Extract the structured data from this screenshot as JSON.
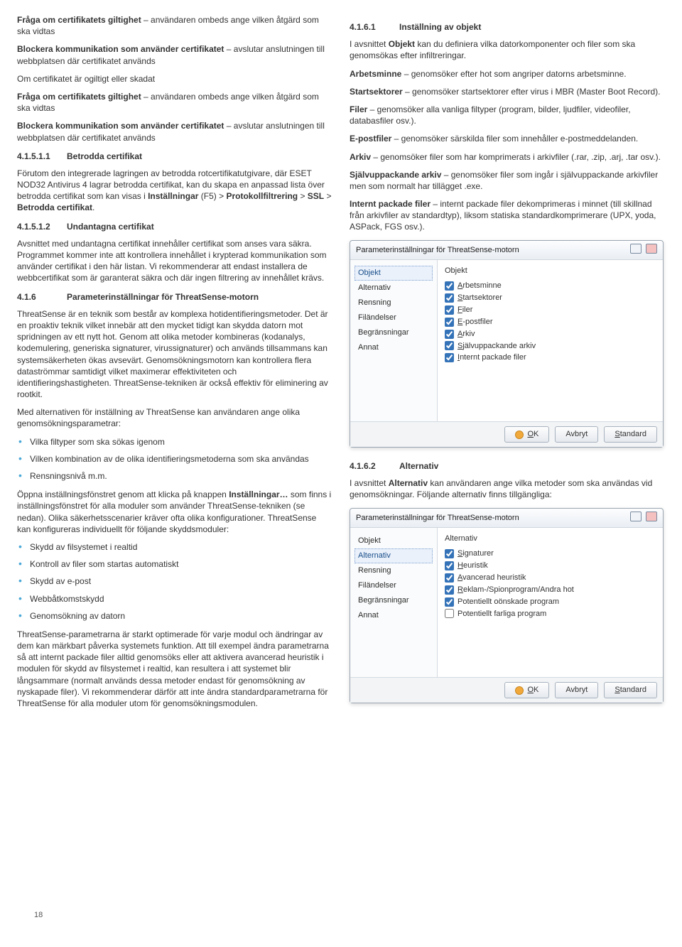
{
  "page_number": "18",
  "left": {
    "p1a": "Fråga om certifikatets giltighet",
    "p1b": " – användaren ombeds ange vilken åtgärd som ska vidtas",
    "p2a": "Blockera kommunikation som använder certifikatet",
    "p2b": " – avslutar anslutningen till webbplatsen där certifikatet används",
    "p3": "Om certifikatet är ogiltigt eller skadat",
    "p4a": "Fråga om certifikatets giltighet",
    "p4b": " – användaren ombeds ange vilken åtgärd som ska vidtas",
    "p5a": "Blockera kommunikation som använder certifikatet",
    "p5b": " – avslutar anslutningen till webbplatsen där certifikatet används",
    "h1": {
      "num": "4.1.5.1.1",
      "title": "Betrodda certifikat"
    },
    "p6a": "Förutom den integrerade lagringen av betrodda rotcertifikatutgivare, där ESET NOD32 Antivirus 4 lagrar betrodda certifikat, kan du skapa en anpassad lista över betrodda certifikat som kan visas i ",
    "p6b": "Inställningar",
    "p6c": " (F5) > ",
    "p6d": "Protokollfiltrering",
    "p6e": " > ",
    "p6f": "SSL",
    "p6g": " > ",
    "p6h": "Betrodda certifikat",
    "p6i": ".",
    "h2": {
      "num": "4.1.5.1.2",
      "title": "Undantagna certifikat"
    },
    "p7": "Avsnittet med undantagna certifikat innehåller certifikat som anses vara säkra. Programmet kommer inte att kontrollera innehållet i krypterad kommunikation som använder certifikat i den här listan. Vi rekommenderar att endast installera de webbcertifikat som är garanterat säkra och där ingen filtrering av innehållet krävs.",
    "h3": {
      "num": "4.1.6",
      "title": "Parameterinställningar för ThreatSense-motorn"
    },
    "p8": "ThreatSense är en teknik som består av komplexa hotidentifieringsmetoder. Det är en proaktiv teknik vilket innebär att den mycket tidigt kan skydda datorn mot spridningen av ett nytt hot. Genom att olika metoder kombineras (kodanalys, kodemulering, generiska signaturer, virussignaturer) och används tillsammans kan systemsäkerheten ökas avsevärt. Genomsökningsmotorn kan kontrollera flera dataströmmar samtidigt vilket maximerar effektiviteten och identifieringshastigheten. ThreatSense-tekniken är också effektiv för eliminering av rootkit.",
    "p9": "Med alternativen för inställning av ThreatSense kan användaren ange olika genomsökningsparametrar:",
    "bul1": [
      "Vilka filtyper som ska sökas igenom",
      "Vilken kombination av de olika identifieringsmetoderna som ska användas",
      "Rensningsnivå m.m."
    ],
    "p10a": "Öppna inställningsfönstret genom att klicka på knappen ",
    "p10b": "Inställningar…",
    "p10c": " som finns i inställningsfönstret för alla moduler som använder ThreatSense-tekniken (se nedan). Olika säkerhetsscenarier kräver ofta olika konfigurationer. ThreatSense kan konfigureras individuellt för följande skyddsmoduler:",
    "bul2": [
      "Skydd av filsystemet i realtid",
      "Kontroll av filer som startas automatiskt",
      "Skydd av e-post",
      "Webbåtkomstskydd",
      "Genomsökning av datorn"
    ],
    "p11": "ThreatSense-parametrarna är starkt optimerade för varje modul och ändringar av dem kan märkbart påverka systemets funktion. Att till exempel ändra parametrarna så att internt packade filer alltid genomsöks eller att aktivera avancerad heuristik i modulen för skydd av filsystemet i realtid, kan resultera i att systemet blir långsammare (normalt används dessa metoder endast för genomsökning av nyskapade filer). Vi rekommenderar därför att inte ändra standardparametrarna för ThreatSense för alla moduler utom för genomsökningsmodulen."
  },
  "right": {
    "h1": {
      "num": "4.1.6.1",
      "title": "Inställning av objekt"
    },
    "p1a": "I avsnittet ",
    "p1b": "Objekt",
    "p1c": " kan du definiera vilka datorkomponenter och filer som ska genomsökas efter infiltreringar.",
    "p2a": "Arbetsminne",
    "p2b": " – genomsöker efter hot som angriper datorns arbetsminne.",
    "p3a": "Startsektorer",
    "p3b": " – genomsöker startsektorer efter virus i MBR (Master Boot Record).",
    "p4a": "Filer",
    "p4b": " – genomsöker alla vanliga filtyper (program, bilder, ljudfiler, videofiler, databasfiler osv.).",
    "p5a": "E-postfiler",
    "p5b": " – genomsöker särskilda filer som innehåller e-postmeddelanden.",
    "p6a": "Arkiv",
    "p6b": " – genomsöker filer som har komprimerats i arkivfiler (.rar, .zip, .arj, .tar osv.).",
    "p7a": "Självuppackande arkiv",
    "p7b": " – genomsöker filer som ingår i självuppackande arkivfiler men som normalt har tillägget .exe.",
    "p8a": "Internt packade filer",
    "p8b": " – internt packade filer dekomprimeras i minnet (till skillnad från arkivfiler av standardtyp), liksom statiska standardkomprimerare (UPX, yoda, ASPack, FGS osv.).",
    "h2": {
      "num": "4.1.6.2",
      "title": "Alternativ"
    },
    "p9a": "I avsnittet ",
    "p9b": "Alternativ",
    "p9c": " kan användaren ange vilka metoder som ska användas vid genomsökningar. Följande alternativ finns tillgängliga:"
  },
  "dialog1": {
    "title": "Parameterinställningar för ThreatSense-motorn",
    "side": [
      "Objekt",
      "Alternativ",
      "Rensning",
      "Filändelser",
      "Begränsningar",
      "Annat"
    ],
    "selected": "Objekt",
    "group_title": "Objekt",
    "checks": [
      {
        "label_pre": "A",
        "label": "rbetsminne",
        "checked": true
      },
      {
        "label_pre": "S",
        "label": "tartsektorer",
        "checked": true
      },
      {
        "label_pre": "F",
        "label": "iler",
        "checked": true
      },
      {
        "label_pre": "E",
        "label": "-postfiler",
        "checked": true
      },
      {
        "label_pre": "A",
        "label": "rkiv",
        "checked": true
      },
      {
        "label_pre": "S",
        "label": "jälvuppackande arkiv",
        "checked": true
      },
      {
        "label_pre": "I",
        "label": "nternt packade filer",
        "checked": true
      }
    ],
    "buttons": {
      "ok_pre": "O",
      "ok": "K",
      "cancel": "Avbryt",
      "std_pre": "S",
      "std": "tandard"
    }
  },
  "dialog2": {
    "title": "Parameterinställningar för ThreatSense-motorn",
    "side": [
      "Objekt",
      "Alternativ",
      "Rensning",
      "Filändelser",
      "Begränsningar",
      "Annat"
    ],
    "selected": "Alternativ",
    "group_title": "Alternativ",
    "checks": [
      {
        "label_pre": "S",
        "label": "ignaturer",
        "checked": true
      },
      {
        "label_pre": "H",
        "label": "euristik",
        "checked": true
      },
      {
        "label_pre": "A",
        "label": "vancerad heuristik",
        "checked": true
      },
      {
        "label_pre": "R",
        "label": "eklam-/Spionprogram/Andra hot",
        "checked": true
      },
      {
        "label_pre": "",
        "label": "Potentiellt oönskade program",
        "checked": true
      },
      {
        "label_pre": "",
        "label": "Potentiellt farliga program",
        "checked": false
      }
    ],
    "buttons": {
      "ok_pre": "O",
      "ok": "K",
      "cancel": "Avbryt",
      "std_pre": "S",
      "std": "tandard"
    }
  }
}
